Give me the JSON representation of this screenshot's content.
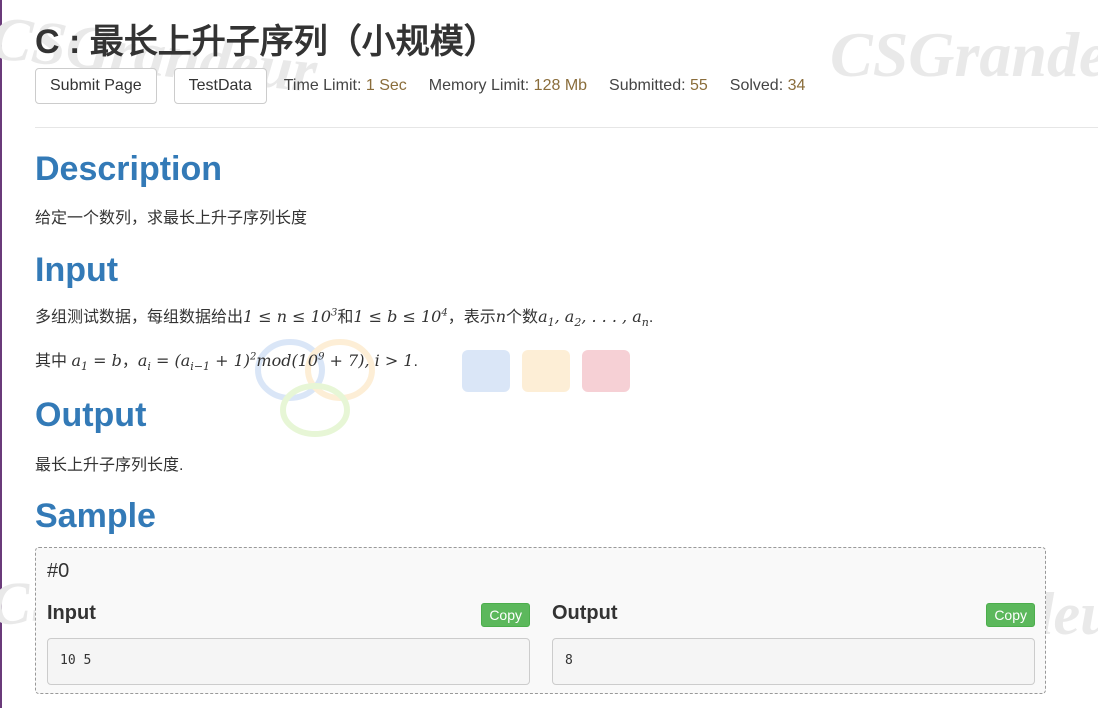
{
  "problem": {
    "title": "C : 最长上升子序列（小规模）"
  },
  "toolbar": {
    "submit_label": "Submit Page",
    "testdata_label": "TestData"
  },
  "stats": {
    "time_label": "Time Limit:",
    "time_value": "1 Sec",
    "memory_label": "Memory Limit:",
    "memory_value": "128 Mb",
    "submitted_label": "Submitted:",
    "submitted_value": "55",
    "solved_label": "Solved:",
    "solved_value": "34"
  },
  "description": {
    "heading": "Description",
    "text": "给定一个数列，求最长上升子序列长度"
  },
  "input": {
    "heading": "Input",
    "line1_a": "多组测试数据，每组数据给出",
    "line1_b": "和",
    "line1_c": "，表示",
    "line1_d": "个数",
    "line2_prefix": "其中"
  },
  "output": {
    "heading": "Output",
    "text": "最长上升子序列长度."
  },
  "sample": {
    "heading": "Sample",
    "case_label": "#0",
    "input_label": "Input",
    "output_label": "Output",
    "copy_label": "Copy",
    "input_value": "10 5",
    "output_value": "8"
  },
  "watermark": {
    "text": "CSGrandeur"
  }
}
